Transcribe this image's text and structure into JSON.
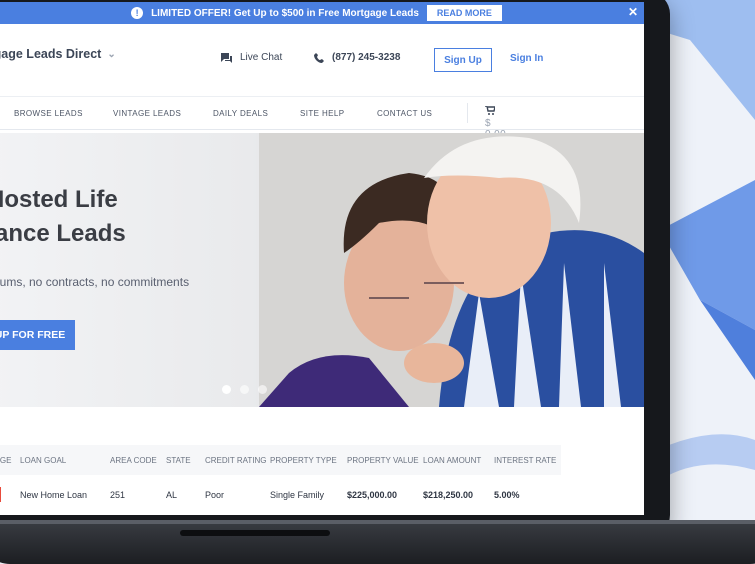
{
  "promo": {
    "text": "LIMITED OFFER! Get Up to $500 in Free Mortgage Leads",
    "cta": "READ MORE",
    "close": "✕",
    "info_icon": "!"
  },
  "header": {
    "brand": "ortgage Leads Direct",
    "live_chat": "Live Chat",
    "phone": "(877) 245-3238",
    "signup": "Sign Up",
    "signin": "Sign In"
  },
  "nav": {
    "items": [
      "BROWSE LEADS",
      "VINTAGE LEADS",
      "DAILY DEALS",
      "SITE HELP",
      "CONTACT US"
    ],
    "cart_total": "$ 0.00"
  },
  "hero": {
    "title_line1": "f-Hosted Life",
    "title_line2": "urance Leads",
    "subtitle": "umums, no contracts, no commitments",
    "cta": "UP FOR FREE",
    "slides_total": 3,
    "active_slide": 1
  },
  "table": {
    "headers": [
      "D AGE",
      "LOAN GOAL",
      "AREA CODE",
      "STATE",
      "CREDIT RATING",
      "PROPERTY TYPE",
      "PROPERTY VALUE",
      "LOAN AMOUNT",
      "INTEREST RATE"
    ],
    "rows": [
      {
        "tag": "W",
        "loan_goal": "New Home Loan",
        "area_code": "251",
        "state": "AL",
        "credit": "Poor",
        "property_type": "Single Family",
        "property_value": "$225,000.00",
        "loan_amount": "$218,250.00",
        "interest_rate": "5.00%"
      }
    ]
  },
  "colors": {
    "accent": "#4a7fe0",
    "tag": "#e84b3c"
  }
}
